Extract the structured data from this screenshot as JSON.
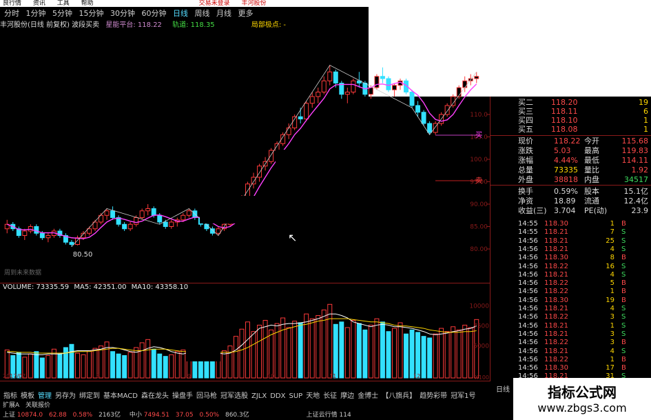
{
  "menu": {
    "items": [
      "良行情",
      "资讯",
      "工具",
      "帮助"
    ],
    "right_items": [
      "交易未登录",
      "丰河股份"
    ]
  },
  "period_tabs": [
    "分时",
    "1分钟",
    "5分钟",
    "15分钟",
    "30分钟",
    "60分钟",
    "日线",
    "周线",
    "月线",
    "更多"
  ],
  "selected_period": "日线",
  "stock_line": {
    "name": "丰河股份(日线 前复权) 波段买卖",
    "a_label": "星能平台:",
    "a_value": "118.22",
    "b_label": "轨道:",
    "b_value": "118.35",
    "c_label": "局部极点:",
    "c_value": "-"
  },
  "chart_labels": {
    "low_point": "80.50",
    "future_text": "周到未来数据",
    "buy": "买",
    "sell": "卖",
    "cursor": "↖"
  },
  "price_axis": [
    "110.0",
    "105.0",
    "100.0",
    "95.00",
    "90.00",
    "85.00",
    "80.00"
  ],
  "volume_header": {
    "label": "VOLUME:",
    "value": "73335.59",
    "ma5_label": "MA5:",
    "ma5": "42351.00",
    "ma10_label": "MA10:",
    "ma10": "43358.10"
  },
  "volume_axis": [
    "10000",
    "7500",
    "5000"
  ],
  "volume_unit": "X100",
  "x_labels": [
    "2017/07",
    "8",
    "9",
    "10",
    "11",
    "12"
  ],
  "chart_data": {
    "type": "candlestick",
    "candles": [
      [
        84.5,
        86.5,
        83.5,
        85.5
      ],
      [
        85.5,
        86.0,
        84.0,
        84.5
      ],
      [
        84.5,
        85.0,
        82.5,
        83.0
      ],
      [
        83.0,
        84.5,
        82.0,
        84.0
      ],
      [
        84.0,
        85.5,
        83.5,
        85.0
      ],
      [
        85.0,
        85.5,
        83.0,
        83.5
      ],
      [
        83.5,
        84.0,
        82.0,
        82.5
      ],
      [
        82.5,
        83.5,
        81.5,
        83.0
      ],
      [
        83.0,
        84.5,
        82.5,
        84.0
      ],
      [
        84.0,
        84.5,
        82.5,
        83.0
      ],
      [
        83.0,
        83.5,
        81.0,
        81.5
      ],
      [
        81.5,
        82.0,
        80.5,
        81.0
      ],
      [
        81.0,
        83.0,
        80.8,
        82.5
      ],
      [
        82.5,
        84.0,
        82.0,
        83.5
      ],
      [
        83.5,
        85.0,
        83.0,
        84.5
      ],
      [
        84.5,
        86.5,
        84.0,
        86.0
      ],
      [
        86.0,
        88.0,
        85.5,
        87.5
      ],
      [
        87.5,
        89.0,
        86.5,
        88.5
      ],
      [
        88.5,
        89.5,
        86.5,
        87.0
      ],
      [
        87.0,
        87.5,
        85.0,
        85.5
      ],
      [
        85.5,
        86.0,
        84.0,
        84.5
      ],
      [
        84.5,
        86.0,
        84.0,
        85.5
      ],
      [
        85.5,
        87.5,
        85.0,
        87.0
      ],
      [
        87.0,
        89.0,
        86.5,
        88.5
      ],
      [
        88.5,
        90.0,
        87.5,
        89.0
      ],
      [
        89.0,
        89.5,
        87.0,
        87.5
      ],
      [
        87.5,
        88.0,
        85.5,
        86.0
      ],
      [
        86.0,
        86.5,
        84.5,
        85.0
      ],
      [
        85.0,
        86.5,
        84.5,
        86.0
      ],
      [
        86.0,
        87.0,
        85.0,
        86.5
      ],
      [
        86.5,
        88.0,
        86.0,
        87.5
      ],
      [
        87.5,
        89.0,
        87.0,
        88.5
      ],
      [
        88.5,
        89.0,
        86.5,
        87.0
      ],
      [
        87.0,
        87.5,
        85.0,
        85.5
      ],
      [
        85.5,
        86.0,
        84.0,
        84.5
      ],
      [
        84.5,
        85.0,
        83.0,
        83.5
      ],
      [
        83.5,
        85.0,
        83.0,
        84.5
      ],
      [
        84.5,
        86.0,
        84.0,
        85.5
      ],
      [
        85.5,
        87.5,
        85.0,
        87.0
      ],
      [
        87.0,
        89.5,
        86.5,
        89.0
      ],
      [
        89.0,
        92.0,
        88.5,
        91.5
      ],
      [
        91.5,
        95.0,
        91.0,
        94.5
      ],
      [
        94.5,
        97.0,
        93.5,
        96.0
      ],
      [
        96.0,
        99.0,
        95.0,
        98.5
      ],
      [
        98.5,
        100.5,
        97.5,
        99.5
      ],
      [
        99.5,
        102.5,
        99.0,
        102.0
      ],
      [
        102.0,
        104.0,
        101.0,
        103.5
      ],
      [
        103.5,
        106.0,
        103.0,
        105.5
      ],
      [
        105.5,
        108.0,
        104.5,
        107.0
      ],
      [
        107.0,
        110.0,
        106.5,
        109.5
      ],
      [
        109.5,
        111.5,
        108.0,
        109.0
      ],
      [
        109.0,
        113.0,
        108.5,
        112.5
      ],
      [
        112.5,
        115.0,
        111.5,
        114.0
      ],
      [
        114.0,
        116.0,
        112.5,
        115.0
      ],
      [
        115.0,
        118.5,
        114.5,
        117.5
      ],
      [
        117.5,
        121.0,
        116.5,
        119.5
      ],
      [
        119.5,
        120.0,
        116.0,
        117.0
      ],
      [
        117.0,
        117.5,
        113.5,
        114.5
      ],
      [
        114.5,
        116.0,
        112.5,
        115.0
      ],
      [
        115.0,
        118.0,
        114.5,
        117.5
      ],
      [
        117.5,
        119.5,
        116.0,
        117.0
      ],
      [
        117.0,
        117.5,
        114.0,
        114.5
      ],
      [
        114.5,
        116.5,
        113.5,
        116.0
      ],
      [
        116.0,
        119.0,
        115.5,
        118.5
      ],
      [
        118.5,
        120.5,
        117.0,
        118.0
      ],
      [
        118.0,
        118.5,
        115.0,
        115.5
      ],
      [
        115.5,
        117.0,
        114.0,
        116.5
      ],
      [
        116.5,
        118.0,
        115.5,
        117.5
      ],
      [
        117.5,
        118.0,
        114.5,
        115.0
      ],
      [
        115.0,
        115.5,
        111.5,
        112.0
      ],
      [
        112.0,
        113.0,
        109.5,
        110.5
      ],
      [
        110.5,
        111.0,
        107.5,
        108.0
      ],
      [
        108.0,
        108.5,
        105.5,
        106.0
      ],
      [
        106.0,
        108.5,
        105.5,
        108.0
      ],
      [
        108.0,
        110.5,
        107.5,
        110.0
      ],
      [
        110.0,
        112.5,
        109.5,
        112.0
      ],
      [
        112.0,
        114.5,
        111.5,
        114.0
      ],
      [
        114.0,
        116.5,
        113.5,
        116.0
      ],
      [
        116.0,
        118.5,
        115.0,
        117.5
      ],
      [
        117.5,
        119.0,
        116.5,
        118.0
      ],
      [
        118.0,
        119.5,
        117.0,
        118.5
      ]
    ],
    "volume": [
      35,
      28,
      32,
      26,
      30,
      33,
      25,
      28,
      36,
      30,
      38,
      42,
      31,
      29,
      34,
      37,
      40,
      45,
      33,
      30,
      28,
      32,
      38,
      44,
      48,
      36,
      30,
      27,
      29,
      33,
      35,
      41,
      37,
      31,
      28,
      26,
      30,
      34,
      40,
      52,
      61,
      70,
      58,
      66,
      72,
      60,
      68,
      75,
      63,
      71,
      69,
      80,
      74,
      78,
      85,
      92,
      67,
      70,
      63,
      72,
      68,
      60,
      66,
      74,
      70,
      58,
      62,
      69,
      55,
      60,
      57,
      52,
      50,
      55,
      62,
      58,
      64,
      60,
      66,
      63,
      73
    ],
    "ma5": [
      32,
      31,
      30,
      30,
      30,
      29,
      29,
      30,
      30,
      30,
      31,
      33,
      34,
      34,
      34,
      35,
      36,
      38,
      38,
      37,
      35,
      33,
      32,
      34,
      37,
      39,
      38,
      36,
      33,
      31,
      30,
      32,
      33,
      34,
      34,
      33,
      31,
      30,
      31,
      35,
      41,
      48,
      55,
      62,
      64,
      66,
      65,
      67,
      68,
      68,
      69,
      70,
      72,
      74,
      77,
      80,
      80,
      78,
      75,
      70,
      68,
      66,
      64,
      66,
      67,
      66,
      64,
      64,
      63,
      62,
      60,
      58,
      55,
      54,
      55,
      56,
      58,
      59,
      61,
      62,
      65
    ],
    "ma10": [
      33,
      33,
      32,
      32,
      32,
      31,
      31,
      31,
      31,
      31,
      31,
      32,
      33,
      33,
      33,
      34,
      35,
      36,
      37,
      37,
      36,
      35,
      34,
      34,
      35,
      36,
      36,
      36,
      35,
      34,
      33,
      33,
      33,
      33,
      33,
      33,
      32,
      32,
      32,
      33,
      35,
      38,
      42,
      46,
      50,
      54,
      57,
      60,
      62,
      64,
      66,
      67,
      69,
      71,
      72,
      74,
      74,
      74,
      74,
      73,
      72,
      71,
      70,
      70,
      69,
      68,
      66,
      65,
      65,
      64,
      63,
      62,
      60,
      59,
      58,
      57,
      57,
      57,
      58,
      58,
      59
    ],
    "ylim": [
      78,
      122
    ],
    "vol_max": 100
  },
  "quote": {
    "rows": [
      {
        "label": "买二",
        "val": "118.20",
        "val_color": "#ff4a4a",
        "extra": "19"
      },
      {
        "label": "买三",
        "val": "118.11",
        "val_color": "#ff4a4a",
        "extra": "6"
      },
      {
        "label": "买四",
        "val": "118.10",
        "val_color": "#ff4a4a",
        "extra": "1"
      },
      {
        "label": "买五",
        "val": "118.08",
        "val_color": "#ff4a4a",
        "extra": "1"
      }
    ],
    "stats": [
      {
        "l1": "现价",
        "v1": "118.22",
        "c1": "#ff4a4a",
        "l2": "今开",
        "v2": "115.68",
        "c2": "#ff4a4a"
      },
      {
        "l1": "涨跌",
        "v1": "5.03",
        "c1": "#ff4a4a",
        "l2": "最高",
        "v2": "119.83",
        "c2": "#ff4a4a"
      },
      {
        "l1": "涨幅",
        "v1": "4.44%",
        "c1": "#ff4a4a",
        "l2": "最低",
        "v2": "114.11",
        "c2": "#ff4a4a"
      },
      {
        "l1": "总量",
        "v1": "73335",
        "c1": "#ffd700",
        "l2": "量比",
        "v2": "1.92",
        "c2": "#ff4a4a"
      },
      {
        "l1": "外盘",
        "v1": "38818",
        "c1": "#ff4a4a",
        "l2": "内盘",
        "v2": "34517",
        "c2": "#3ddc5e"
      },
      {
        "l1": "换手",
        "v1": "0.59%",
        "c1": "#ddd",
        "l2": "股本",
        "v2": "15.1亿",
        "c2": "#ddd"
      },
      {
        "l1": "净资",
        "v1": "18.89",
        "c1": "#ddd",
        "l2": "流通",
        "v2": "12.4亿",
        "c2": "#ddd"
      },
      {
        "l1": "收益(三)",
        "v1": "3.704",
        "c1": "#ddd",
        "l2": "PE(动)",
        "v2": "23.9",
        "c2": "#ddd"
      }
    ]
  },
  "ticks": [
    {
      "t": "14:55",
      "p": "118.30",
      "n": "1",
      "s": "B"
    },
    {
      "t": "14:55",
      "p": "118.21",
      "n": "7",
      "s": "S"
    },
    {
      "t": "14:56",
      "p": "118.21",
      "n": "25",
      "s": "S"
    },
    {
      "t": "14:56",
      "p": "118.21",
      "n": "4",
      "s": "S"
    },
    {
      "t": "14:56",
      "p": "118.30",
      "n": "8",
      "s": "B"
    },
    {
      "t": "14:56",
      "p": "118.22",
      "n": "16",
      "s": "S"
    },
    {
      "t": "14:56",
      "p": "118.21",
      "n": "4",
      "s": "S"
    },
    {
      "t": "14:56",
      "p": "118.22",
      "n": "5",
      "s": "B"
    },
    {
      "t": "14:56",
      "p": "118.22",
      "n": "1",
      "s": "B"
    },
    {
      "t": "14:56",
      "p": "118.30",
      "n": "19",
      "s": "B"
    },
    {
      "t": "14:56",
      "p": "118.21",
      "n": "4",
      "s": "S"
    },
    {
      "t": "14:56",
      "p": "118.22",
      "n": "3",
      "s": "S"
    },
    {
      "t": "14:56",
      "p": "118.21",
      "n": "1",
      "s": "S"
    },
    {
      "t": "14:56",
      "p": "118.21",
      "n": "3",
      "s": "S"
    },
    {
      "t": "14:56",
      "p": "118.22",
      "n": "3",
      "s": "B"
    },
    {
      "t": "14:56",
      "p": "118.21",
      "n": "4",
      "s": "S"
    },
    {
      "t": "14:56",
      "p": "118.22",
      "n": "1",
      "s": "B"
    },
    {
      "t": "14:56",
      "p": "118.30",
      "n": "17",
      "s": "B"
    },
    {
      "t": "14:56",
      "p": "118.21",
      "n": "31",
      "s": "S"
    }
  ],
  "tabs": [
    "指标",
    "模板",
    "管理",
    "另存为",
    "绑定到",
    "基本MACD",
    "森在龙头",
    "操盘手",
    "回马枪",
    "冠军选股",
    "ZJLX",
    "DDX",
    "SUP",
    "天地",
    "长征",
    "摩边",
    "金博士",
    "【八旗兵】",
    "趋势彩带",
    "冠军1号"
  ],
  "selected_tab": "管理",
  "day_tab": "日线",
  "bottom1": {
    "a": "扩展A",
    "b": "关联报价"
  },
  "bottom2": {
    "sh": "上证",
    "sh_val": "10874.0",
    "sh_chg": "62.88",
    "sh_pct": "0.58%",
    "amt": "2163亿",
    "mid": "中小",
    "mid_val": "7494.51",
    "mid_chg": "37.05",
    "mid_pct": "0.50%",
    "mid_amt": "860.3亿",
    "cloud": "上证云行情",
    "cloud_val": "114"
  },
  "watermark": {
    "cn": "指标公式网",
    "url": "www.zbgs3.com"
  }
}
